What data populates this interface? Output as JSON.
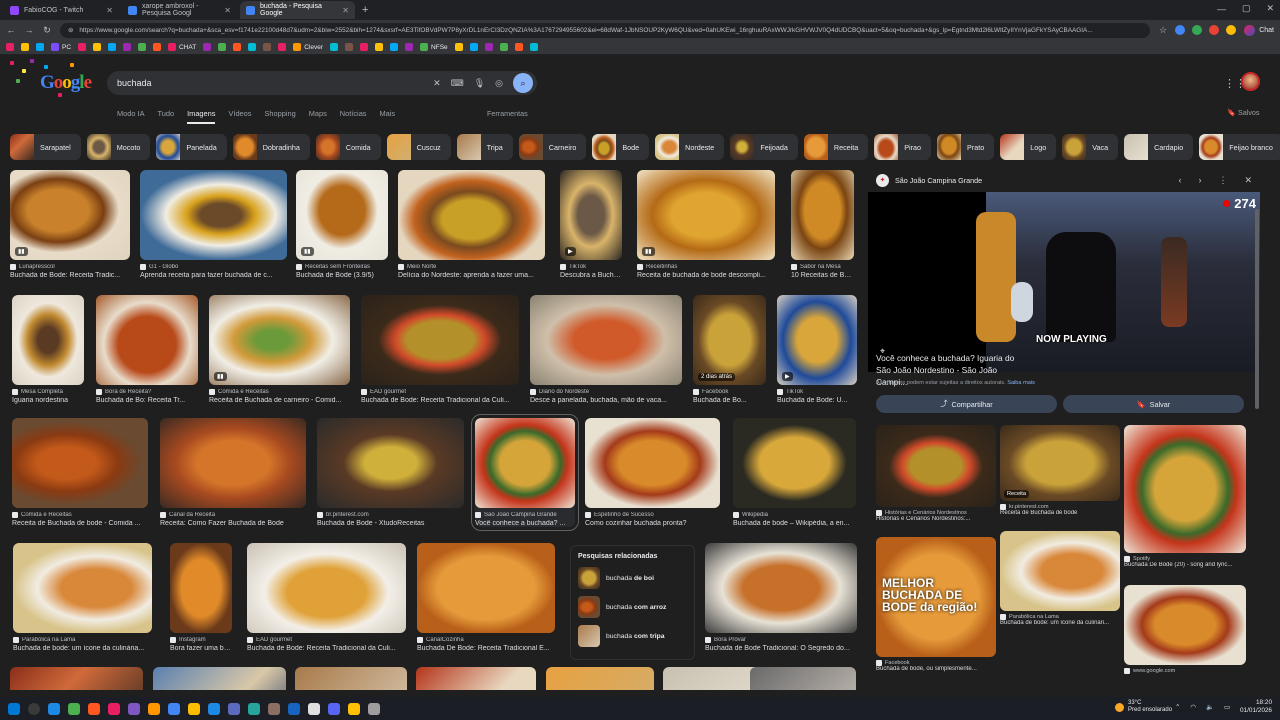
{
  "browser": {
    "tabs": [
      {
        "title": "FabioCOG - Twitch",
        "color": "#9146ff",
        "active": false
      },
      {
        "title": "xarope ambroxol - Pesquisa Googl",
        "color": "#4285f4",
        "active": false
      },
      {
        "title": "buchada - Pesquisa Google",
        "color": "#4285f4",
        "active": true
      }
    ],
    "new_tab": "+",
    "url": "https://www.google.com/search?q=buchada+&sca_esv=f1741e22100d48d7&udm=2&biw=2552&bih=1274&sxsrf=AE3TifOBVdPW7P8yXrDL1nErCI3DzQNZIA%3A1767294955602&ei=68dWaf-1JbNSOUP2KyW6QU&ved=0ahUKEwi_16rghuuRAxWWJrkGHVWJV0Q4dUDCBQ&uact=5&oq=buchada+&gs_lp=Egtnd3Mtd2l6LWltZyIIYnVjaGFkYSAyCBAAGIA...",
    "chat_label": "Chat",
    "bookmarks": [
      {
        "label": "PC",
        "color": "#7c4dff"
      },
      {
        "label": "CHAT",
        "color": "#e91e63"
      },
      {
        "label": "Clever",
        "color": "#ff9800"
      },
      {
        "label": "NFSe",
        "color": "#4caf50"
      }
    ]
  },
  "google": {
    "query": "buchada",
    "tabs": [
      "Modo IA",
      "Tudo",
      "Imagens",
      "Vídeos",
      "Shopping",
      "Maps",
      "Notícias",
      "Mais"
    ],
    "active_tab": "Imagens",
    "tools": "Ferramentas",
    "saved": "Salvos",
    "chips": [
      {
        "label": "Sarapatel",
        "tex": "f26"
      },
      {
        "label": "Mocoto",
        "tex": "f5"
      },
      {
        "label": "Panelada",
        "tex": "f14"
      },
      {
        "label": "Dobradinha",
        "tex": "f22"
      },
      {
        "label": "Comida",
        "tex": "f16"
      },
      {
        "label": "Cuscuz",
        "tex": "f30"
      },
      {
        "label": "Tripa",
        "tex": "f28"
      },
      {
        "label": "Carneiro",
        "tex": "f15"
      },
      {
        "label": "Bode",
        "tex": "f4"
      },
      {
        "label": "Nordeste",
        "tex": "f21"
      },
      {
        "label": "Feijoada",
        "tex": "f17"
      },
      {
        "label": "Receita",
        "tex": "f24"
      },
      {
        "label": "Pirao",
        "tex": "f9"
      },
      {
        "label": "Prato",
        "tex": "f7"
      },
      {
        "label": "Logo",
        "tex": "f29"
      },
      {
        "label": "Vaca",
        "tex": "f13"
      },
      {
        "label": "Cardapio",
        "tex": "f31"
      },
      {
        "label": "Feijao branco",
        "tex": "f19"
      }
    ],
    "results": [
      {
        "source": "Lunapresscol",
        "title": "Buchada de Bode: Receita Tradic...",
        "tex": "f1",
        "badge": "▮▮"
      },
      {
        "source": "G1 - Globo",
        "title": "Aprenda receita para fazer buchada de c...",
        "tex": "f2",
        "badge": ""
      },
      {
        "source": "Receitas sem Fronteiras",
        "title": "Buchada de Bode (3.9/5)",
        "tex": "f3",
        "badge": "▮▮"
      },
      {
        "source": "Meio Norte",
        "title": "Delícia do Nordeste: aprenda a fazer uma...",
        "tex": "f4",
        "badge": ""
      },
      {
        "source": "TikTok",
        "title": "Descubra a Bucha...",
        "tex": "f5",
        "badge": "▶"
      },
      {
        "source": "Receitinhas",
        "title": "Receita de buchada de bode descompli...",
        "tex": "f6",
        "badge": "▮▮"
      },
      {
        "source": "Sabor na Mesa",
        "title": "10 Receitas de Bu...",
        "tex": "f7",
        "badge": ""
      },
      {
        "source": "Mesa Completa",
        "title": "Iguaria nordestina",
        "tex": "f8",
        "badge": ""
      },
      {
        "source": "Bora de Receita?",
        "title": "Buchada de Bo: Receita Tr...",
        "tex": "f9",
        "badge": ""
      },
      {
        "source": "Comida e Receitas",
        "title": "Receita de Buchada de carneiro - Comid...",
        "tex": "f10",
        "badge": "▮▮"
      },
      {
        "source": "EAD gourmet",
        "title": "Buchada de Bode: Receita Tradicional da Culi...",
        "tex": "f11",
        "badge": ""
      },
      {
        "source": "Diário do Nordeste",
        "title": "Desce a panelada, buchada, mão de vaca...",
        "tex": "f12",
        "badge": ""
      },
      {
        "source": "Facebook",
        "title": "Buchada de Bo...",
        "tex": "f13",
        "badge": "2 dias atrás"
      },
      {
        "source": "TikTok",
        "title": "Buchada de Bode: U...",
        "tex": "f14",
        "badge": "▶"
      },
      {
        "source": "Comida e Receitas",
        "title": "Receita de Buchada de bode - Comida ...",
        "tex": "f15",
        "badge": ""
      },
      {
        "source": "Canal da Receita",
        "title": "Receita: Como Fazer Buchada de Bode",
        "tex": "f16",
        "badge": ""
      },
      {
        "source": "br.pinterest.com",
        "title": "Buchada de Bode - XtudoReceitas",
        "tex": "f17",
        "badge": ""
      },
      {
        "source": "São João Campina Grande",
        "title": "Você conhece a buchada? ...",
        "tex": "f18",
        "badge": ""
      },
      {
        "source": "Espetinho de Sucesso",
        "title": "Como cozinhar buchada pronta?",
        "tex": "f19",
        "badge": ""
      },
      {
        "source": "Wikipedia",
        "title": "Buchada de bode – Wikipédia, a en...",
        "tex": "f20",
        "badge": ""
      },
      {
        "source": "Parabólica na Lama",
        "title": "Buchada de bode: um ícone da culinária...",
        "tex": "f21",
        "badge": ""
      },
      {
        "source": "Instagram",
        "title": "Bora fazer uma bu...",
        "tex": "f22",
        "badge": ""
      },
      {
        "source": "EAD gourmet",
        "title": "Buchada de Bode: Receita Tradicional da Culi...",
        "tex": "f23",
        "badge": ""
      },
      {
        "source": "CanalCozinha",
        "title": "Buchada De Bode: Receita Tradicional E...",
        "tex": "f24",
        "badge": ""
      },
      {
        "source": "Bora Provar",
        "title": "Buchada de Bode Tradicional: O Segredo do...",
        "tex": "f25",
        "badge": ""
      },
      {
        "source": "",
        "title": "",
        "tex": "f26",
        "badge": ""
      },
      {
        "source": "",
        "title": "",
        "tex": "f27",
        "badge": ""
      },
      {
        "source": "",
        "title": "",
        "tex": "f28",
        "badge": ""
      },
      {
        "source": "",
        "title": "",
        "tex": "f29",
        "badge": ""
      },
      {
        "source": "",
        "title": "",
        "tex": "f30",
        "badge": ""
      },
      {
        "source": "",
        "title": "",
        "tex": "f31",
        "badge": ""
      },
      {
        "source": "",
        "title": "",
        "tex": "f32",
        "badge": ""
      }
    ],
    "related": {
      "heading": "Pesquisas relacionadas",
      "items": [
        {
          "prefix": "buchada ",
          "bold": "de boi",
          "tex": "f13"
        },
        {
          "prefix": "buchada ",
          "bold": "com arroz",
          "tex": "f15"
        },
        {
          "prefix": "buchada ",
          "bold": "com tripa",
          "tex": "f28"
        }
      ]
    }
  },
  "panel": {
    "source": "São João Campina Grande",
    "title": "Você conhece a buchada? Iguaria do São João Nordestino - São João Campi...",
    "note": "As imagens podem estar sujeitas a direitos autorais.",
    "note_link": "Saiba mais",
    "share": "Compartilhar",
    "save": "Salvar",
    "viewers": "274",
    "now_playing": "NOW PLAYING",
    "similar": [
      {
        "source": "Histórias e Cenários Nordestinos",
        "title": "Histórias e Cenários Nordestinos:...",
        "tex": "f11"
      },
      {
        "source": "kr.pinterest.com",
        "title": "Receita de Buchada de bode",
        "tex": "f13",
        "badge": "Receita"
      },
      {
        "source": "Spotify",
        "title": "Buchada De Bode (20) - song and lyric...",
        "tex": "f18"
      },
      {
        "source": "Facebook",
        "title": "Buchada de bode, ou simplesmente...",
        "tex": "f24",
        "promo": "MELHOR BUCHADA DE BODE da região!"
      },
      {
        "source": "Parabólica na Lama",
        "title": "Buchada de bode: um ícone da culinári...",
        "tex": "f21"
      },
      {
        "source": "www.google.com",
        "title": "",
        "tex": "f19"
      }
    ]
  },
  "taskbar": {
    "weather_temp": "33°C",
    "weather_desc": "Pred ensolarado",
    "time": "18:20",
    "date": "01/01/2026"
  }
}
